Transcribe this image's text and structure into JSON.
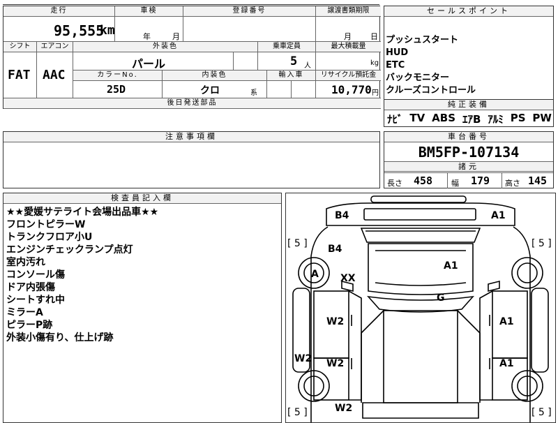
{
  "mileage": {
    "label": "走行",
    "value": "95,555",
    "unit": "km"
  },
  "inspection": {
    "label": "車検",
    "year_unit": "年",
    "month_unit": "月"
  },
  "registration": {
    "label": "登録番号"
  },
  "transfer": {
    "label": "譲渡書類期限",
    "month_unit": "月",
    "day_unit": "日"
  },
  "shift": {
    "label": "シフト",
    "value": "FAT"
  },
  "aircon": {
    "label": "エアコン",
    "value": "AAC"
  },
  "exterior": {
    "label": "外装色",
    "value": "パール"
  },
  "capacity": {
    "label": "乗車定員",
    "value": "5",
    "unit": "人"
  },
  "max_load": {
    "label": "最大積載量",
    "unit": "kg"
  },
  "color_no": {
    "label": "カラーNo.",
    "value": "25D"
  },
  "interior": {
    "label": "内装色",
    "value": "クロ",
    "suffix": "系"
  },
  "import": {
    "label": "輸入車"
  },
  "recycle": {
    "label": "リサイクル預託金",
    "value": "10,770",
    "unit": "円"
  },
  "later_parts": {
    "label": "後日発送部品"
  },
  "caution": {
    "label": "注意事項欄"
  },
  "sales": {
    "label": "セールスポイント",
    "items": [
      "プッシュスタート",
      "HUD",
      "ETC",
      "バックモニター",
      "クルーズコントロール"
    ]
  },
  "equipment": {
    "label": "純正装備",
    "items": [
      "ﾅﾋﾞ",
      "TV",
      "ABS",
      "ｴｱB",
      "ｱﾙﾐ",
      "PS",
      "PW"
    ]
  },
  "chassis": {
    "label": "車台番号",
    "value": "BM5FP-107134"
  },
  "specs": {
    "label": "諸元",
    "length_label": "長さ",
    "length": "458",
    "width_label": "幅",
    "width": "179",
    "height_label": "高さ",
    "height": "145"
  },
  "inspector": {
    "label": "検査員記入欄",
    "notes": [
      "★★愛媛サテライト会場出品車★★",
      "フロントピラーW",
      "トランクフロア小U",
      "エンジンチェックランプ点灯",
      "室内汚れ",
      "コンソール傷",
      "ドア内張傷",
      "シートすれ中",
      "ミラーA",
      "ピラーP跡",
      "外装小傷有り、仕上げ跡"
    ]
  },
  "diagram": {
    "marks": [
      "B4",
      "A1",
      "B4",
      "A1",
      "A",
      "XX",
      "G",
      "W2",
      "A1",
      "W2",
      "W2",
      "A1",
      "W2"
    ],
    "tire_tread": [
      "[ 5 ]",
      "[ 5 ]",
      "[ 5 ]",
      "[ 5 ]"
    ]
  }
}
